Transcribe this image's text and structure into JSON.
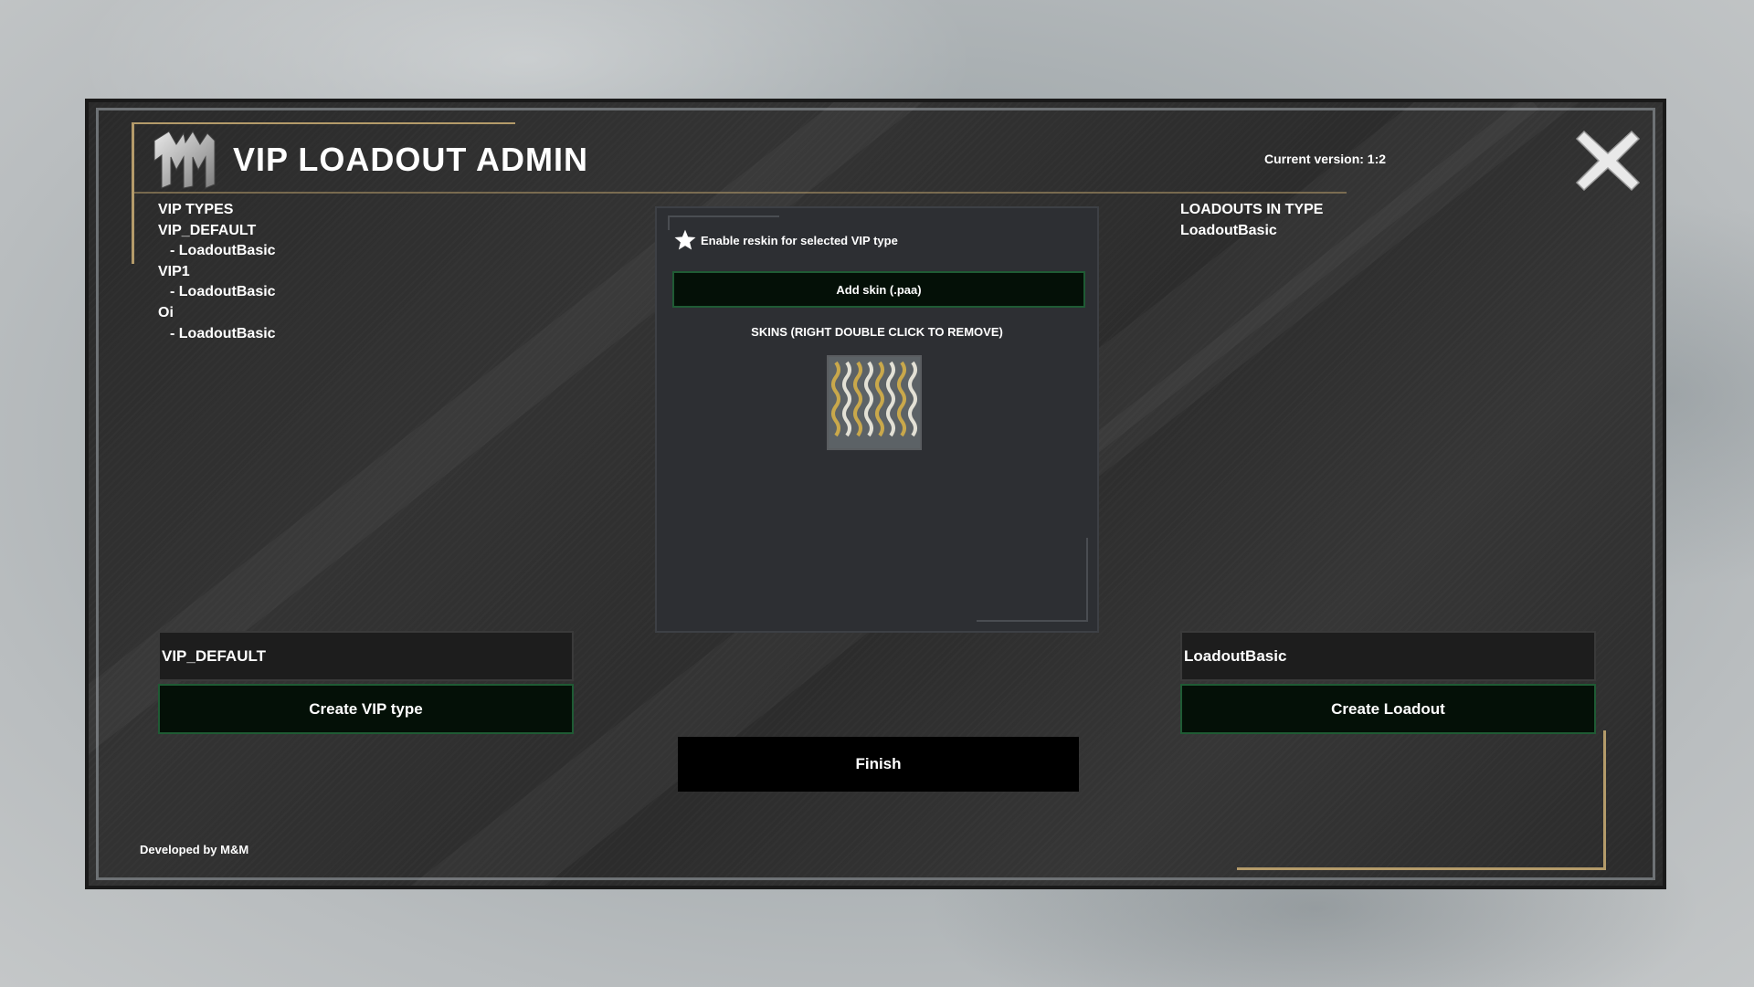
{
  "window": {
    "title": "VIP LOADOUT ADMIN",
    "version": "Current version: 1:2",
    "logo_icon": "mm-logo-icon",
    "close_icon": "close-x-icon",
    "footer": "Developed by M&M"
  },
  "vip_tree": {
    "header": "VIP TYPES",
    "types": [
      {
        "name": "VIP_DEFAULT",
        "children": [
          "- LoadoutBasic"
        ]
      },
      {
        "name": "VIP1",
        "children": [
          "- LoadoutBasic"
        ]
      },
      {
        "name": "Oi",
        "children": [
          "- LoadoutBasic"
        ]
      }
    ]
  },
  "loadouts": {
    "header": "LOADOUTS IN TYPE",
    "items": [
      "LoadoutBasic"
    ]
  },
  "reskin": {
    "checkbox_label": "Enable reskin for selected VIP type",
    "checkbox_icon": "star-icon",
    "add_skin_label": "Add skin (.paa)",
    "skins_title": "SKINS (RIGHT DOUBLE CLICK TO REMOVE)"
  },
  "vip_form": {
    "input_value": "VIP_DEFAULT",
    "create_label": "Create VIP type"
  },
  "loadout_form": {
    "input_value": "LoadoutBasic",
    "create_label": "Create Loadout"
  },
  "finish_label": "Finish",
  "colors": {
    "accent_gold": "#b49b6a",
    "button_green_border": "#1f5b34",
    "button_bg": "#041007"
  }
}
